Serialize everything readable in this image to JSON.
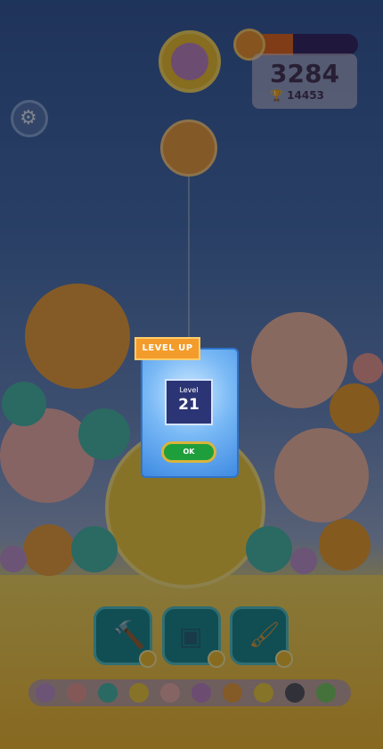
{
  "score": {
    "value": "3284",
    "best": "14453",
    "best_icon": "trophy-icon"
  },
  "level_progress": {
    "fraction": 0.45,
    "badge_icon": "level-badge-icon"
  },
  "next_ball": {
    "icon": "purple-cat-face-icon"
  },
  "settings": {
    "icon": "gear-icon"
  },
  "board": {
    "current_drop": "orange-hamster-icon",
    "balls": [
      "orange-hamster",
      "peach-otter",
      "teal-bird",
      "pink-hamster",
      "yellow-cat",
      "orange-hedgehog",
      "purple-ball"
    ]
  },
  "level_up": {
    "ribbon": "LEVEL UP",
    "level_label": "Level",
    "level_number": "21",
    "ok_label": "OK"
  },
  "toolbar": {
    "items": [
      {
        "name": "hammer",
        "icon": "hammer-icon"
      },
      {
        "name": "box",
        "icon": "box-icon"
      },
      {
        "name": "brush",
        "icon": "brush-icon"
      }
    ]
  },
  "evolution": {
    "icons": [
      "purple-ball",
      "pink-cat",
      "teal-bird",
      "yellow-cat",
      "pink-hamster",
      "purple-cat",
      "orange-hamster",
      "yellow-chick",
      "dark-cat",
      "green-frog"
    ]
  },
  "colors": {
    "accent": "#f39c2b",
    "ok": "#1f9e3c",
    "modal_bg": "#3f8be3"
  }
}
